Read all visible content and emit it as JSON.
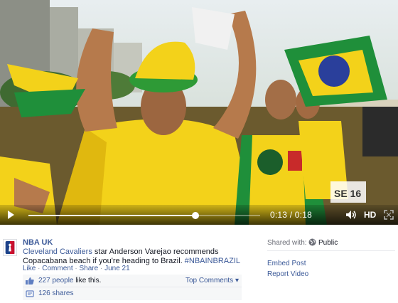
{
  "video": {
    "scene_description_icon": "video-frame",
    "current_time": "0:13",
    "duration": "0:18",
    "time_separator": "/",
    "progress_fraction": 0.722,
    "hd_label": "HD",
    "banner_text": "SE 16"
  },
  "post": {
    "page_name": "NBA UK",
    "caption_link": "Cleveland Cavaliers",
    "caption_text": " star Anderson Varejao recommends Copacabana beach if you're heading to Brazil. ",
    "caption_hashtag": "#NBAINBRAZIL",
    "actions": {
      "like": "Like",
      "comment": "Comment",
      "share": "Share",
      "date": "June 21",
      "separator": " · "
    },
    "likes": {
      "count_link": "227 people",
      "suffix": " like this.",
      "top_comments": "Top Comments"
    },
    "shares": {
      "count_link": "126 shares"
    }
  },
  "side": {
    "shared_with_label": "Shared with:",
    "audience": "Public",
    "embed_post": "Embed Post",
    "report_video": "Report Video"
  },
  "colors": {
    "link": "#3b5998",
    "brazil_yellow": "#f3d21a",
    "brazil_green": "#1f8f3a",
    "brazil_blue": "#2a3f9b"
  }
}
